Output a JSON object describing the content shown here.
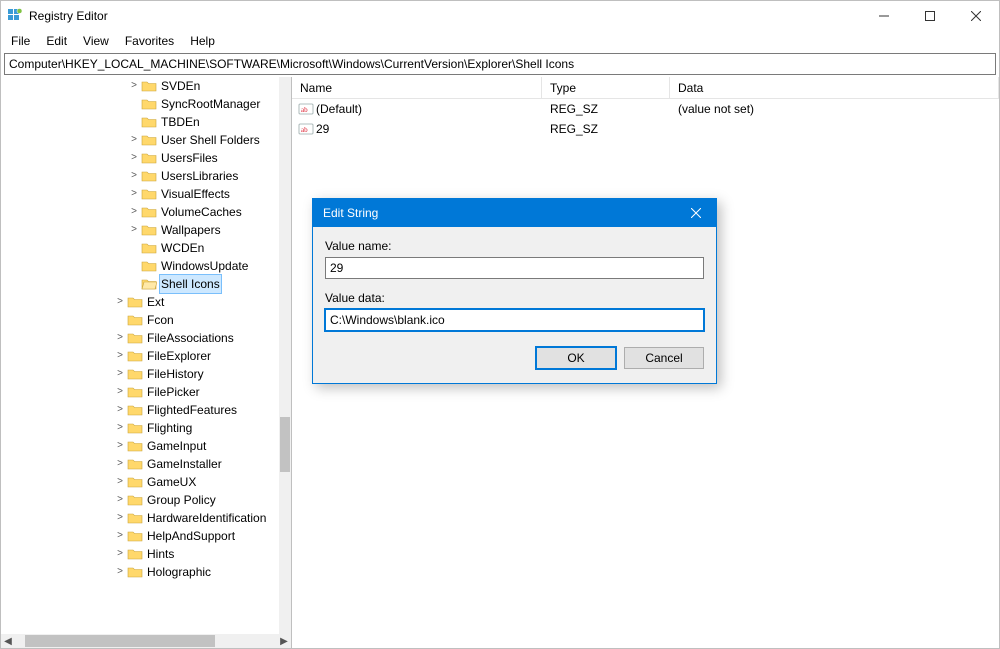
{
  "window": {
    "title": "Registry Editor"
  },
  "menubar": [
    "File",
    "Edit",
    "View",
    "Favorites",
    "Help"
  ],
  "address": "Computer\\HKEY_LOCAL_MACHINE\\SOFTWARE\\Microsoft\\Windows\\CurrentVersion\\Explorer\\Shell Icons",
  "tree": [
    {
      "indent": 7,
      "expander": ">",
      "label": "SVDEn"
    },
    {
      "indent": 7,
      "expander": "",
      "label": "SyncRootManager"
    },
    {
      "indent": 7,
      "expander": "",
      "label": "TBDEn"
    },
    {
      "indent": 7,
      "expander": ">",
      "label": "User Shell Folders"
    },
    {
      "indent": 7,
      "expander": ">",
      "label": "UsersFiles"
    },
    {
      "indent": 7,
      "expander": ">",
      "label": "UsersLibraries"
    },
    {
      "indent": 7,
      "expander": ">",
      "label": "VisualEffects"
    },
    {
      "indent": 7,
      "expander": ">",
      "label": "VolumeCaches"
    },
    {
      "indent": 7,
      "expander": ">",
      "label": "Wallpapers"
    },
    {
      "indent": 7,
      "expander": "",
      "label": "WCDEn"
    },
    {
      "indent": 7,
      "expander": "",
      "label": "WindowsUpdate"
    },
    {
      "indent": 7,
      "expander": "",
      "label": "Shell Icons",
      "selected": true
    },
    {
      "indent": 6,
      "expander": ">",
      "label": "Ext"
    },
    {
      "indent": 6,
      "expander": "",
      "label": "Fcon"
    },
    {
      "indent": 6,
      "expander": ">",
      "label": "FileAssociations"
    },
    {
      "indent": 6,
      "expander": ">",
      "label": "FileExplorer"
    },
    {
      "indent": 6,
      "expander": ">",
      "label": "FileHistory"
    },
    {
      "indent": 6,
      "expander": ">",
      "label": "FilePicker"
    },
    {
      "indent": 6,
      "expander": ">",
      "label": "FlightedFeatures"
    },
    {
      "indent": 6,
      "expander": ">",
      "label": "Flighting"
    },
    {
      "indent": 6,
      "expander": ">",
      "label": "GameInput"
    },
    {
      "indent": 6,
      "expander": ">",
      "label": "GameInstaller"
    },
    {
      "indent": 6,
      "expander": ">",
      "label": "GameUX"
    },
    {
      "indent": 6,
      "expander": ">",
      "label": "Group Policy"
    },
    {
      "indent": 6,
      "expander": ">",
      "label": "HardwareIdentification"
    },
    {
      "indent": 6,
      "expander": ">",
      "label": "HelpAndSupport"
    },
    {
      "indent": 6,
      "expander": ">",
      "label": "Hints"
    },
    {
      "indent": 6,
      "expander": ">",
      "label": "Holographic"
    }
  ],
  "list": {
    "headers": {
      "name": "Name",
      "type": "Type",
      "data": "Data"
    },
    "rows": [
      {
        "icon": "string",
        "name": "(Default)",
        "type": "REG_SZ",
        "data": "(value not set)"
      },
      {
        "icon": "string",
        "name": "29",
        "type": "REG_SZ",
        "data": ""
      }
    ]
  },
  "dialog": {
    "title": "Edit String",
    "value_name_label": "Value name:",
    "value_name": "29",
    "value_data_label": "Value data:",
    "value_data": "C:\\Windows\\blank.ico",
    "ok": "OK",
    "cancel": "Cancel"
  }
}
